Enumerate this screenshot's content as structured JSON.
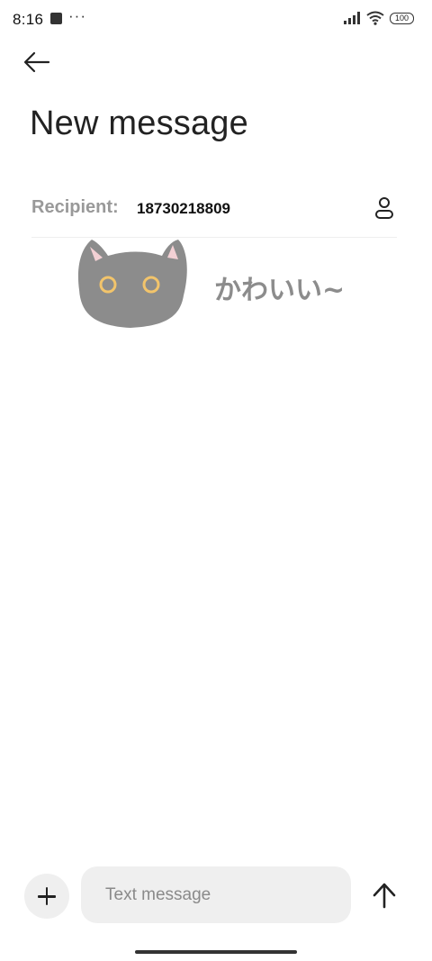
{
  "status_bar": {
    "time": "8:16",
    "extra": "···",
    "battery": "100"
  },
  "header": {
    "title": "New message"
  },
  "recipient": {
    "label": "Recipient:",
    "value": "18730218809"
  },
  "sticker": {
    "caption": "かわいい~",
    "description_icon": "black-cat-sticker"
  },
  "composer": {
    "placeholder": "Text message"
  },
  "colors": {
    "background": "#ffffff",
    "input_bg": "#efefef",
    "label_gray": "#999999",
    "cat_gray": "#8c8c8c",
    "cat_eye": "#f2c46b"
  }
}
